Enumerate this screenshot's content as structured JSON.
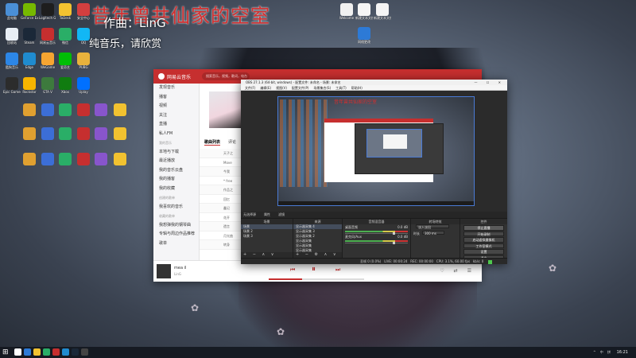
{
  "desktop": {
    "lyric_main": "昔年曾共仙家的空室",
    "lyric_sub1": "作曲：LinG",
    "lyric_sub2": "纯音乐，请欣赏",
    "icons": [
      {
        "label": "此电脑",
        "color": "#4a8fd6"
      },
      {
        "label": "GeForce Experience",
        "color": "#76b900"
      },
      {
        "label": "Logitech G HUB",
        "color": "#1e1e1e"
      },
      {
        "label": "ToDesk",
        "color": "#f2c230"
      },
      {
        "label": "安全中心",
        "color": "#d33f3f"
      },
      {
        "label": "回收站",
        "color": "#e8eef5"
      },
      {
        "label": "Steam",
        "color": "#1b2838"
      },
      {
        "label": "网易云音乐",
        "color": "#c62f2f"
      },
      {
        "label": "微信",
        "color": "#2aae67"
      },
      {
        "label": "QQ",
        "color": "#12b7f5"
      },
      {
        "label": "酷狗音乐",
        "color": "#2c86e6"
      },
      {
        "label": "Edge",
        "color": "#1f8bcf"
      },
      {
        "label": "WeGame",
        "color": "#f6a531"
      },
      {
        "label": "爱奇艺",
        "color": "#00be06"
      },
      {
        "label": "PUBG",
        "color": "#e8b23c"
      },
      {
        "label": "Epic Games",
        "color": "#2c2c2c"
      },
      {
        "label": "Rockstar",
        "color": "#f7b500"
      },
      {
        "label": "GTA V",
        "color": "#3d7a3d"
      },
      {
        "label": "Xbox",
        "color": "#107c10"
      },
      {
        "label": "Uplay",
        "color": "#0070ff"
      }
    ],
    "right_icons": [
      {
        "label": "Welcome",
        "color": "#f0f0f0"
      },
      {
        "label": "新建文本文档",
        "color": "#f5f5f5"
      },
      {
        "label": "新建文本文档",
        "color": "#f5f5f5"
      },
      {
        "label": "网络更改",
        "color": "#2d7ad6"
      }
    ]
  },
  "music": {
    "app_title": "网易云音乐",
    "search_placeholder": "搜索音乐，视频，歌词，电台",
    "sidebar": [
      "发现音乐",
      "播客",
      "视频",
      "关注",
      "直播",
      "私人FM",
      "我的音乐",
      "本地与下载",
      "最近播放",
      "我的音乐云盘",
      "我的播客",
      "我的收藏",
      "创建的歌单",
      "我喜欢的音乐",
      "收藏的歌单",
      "我想弹我的钢琴曲",
      "专辑与周边作品推荐",
      "歌单"
    ],
    "tabs": [
      "歌曲列表",
      "评论",
      "收藏者"
    ],
    "song_rows": [
      "天子之",
      "Move",
      "今我",
      "* free",
      "作品之",
      "回忆",
      "鑫记",
      "花开",
      "遗言",
      "月光曲",
      "转身"
    ],
    "player": {
      "title": "mea il",
      "artist": "LinG",
      "progress": 0.35,
      "prev_icon": "prev-icon",
      "play_icon": "play-icon",
      "next_icon": "next-icon"
    }
  },
  "obs": {
    "title": "OBS 27.1.3 (64-bit, windows) - 配置文件: 未命名 - 场景: 未命名",
    "menu": [
      "文件(F)",
      "编辑(E)",
      "视图(V)",
      "配置文件(P)",
      "场景集合(S)",
      "工具(T)",
      "帮助(H)"
    ],
    "preview_lyric": "昔年曾共仙家的空室",
    "dock_titles": [
      "无选择源",
      "属性",
      "滤镜"
    ],
    "panels": {
      "scenes": {
        "title": "场景",
        "items": [
          "场景",
          "场景 2",
          "场景 3"
        ]
      },
      "sources": {
        "title": "来源",
        "items": [
          "显示器采集 4",
          "显示器采集 3",
          "显示器采集 2",
          "显示器采集",
          "显示器采集",
          "显示器采集"
        ]
      },
      "mixer": {
        "title": "音频混音器",
        "channels": [
          {
            "name": "桌面音频",
            "level": "0.0 dB"
          },
          {
            "name": "麦克风/Aux",
            "level": "0.0 dB"
          }
        ]
      },
      "transitions": {
        "title": "转场特效",
        "type": "淡入淡出",
        "duration_label": "时长",
        "duration": "300 ms"
      },
      "controls": {
        "title": "控件",
        "buttons": [
          "停止直播",
          "开始录制",
          "启动虚拟摄像机",
          "工作室模式",
          "设置",
          "退出"
        ]
      }
    },
    "status": {
      "dropped": "丢帧 0 (0.0%)",
      "live": "LIVE: 00:00:24",
      "rec": "REC: 00:00:00",
      "cpu": "CPU: 3.1%, 60.00 fps",
      "kbps": "kb/s: 0"
    }
  },
  "taskbar": {
    "clock": "16:21",
    "tray_text": "^ 中 拼",
    "icon_colors": [
      "#ffffff",
      "#2d7ad6",
      "#f2c230",
      "#2aae67",
      "#c62f2f",
      "#1f8bcf",
      "#1b2838",
      "#444444"
    ]
  }
}
